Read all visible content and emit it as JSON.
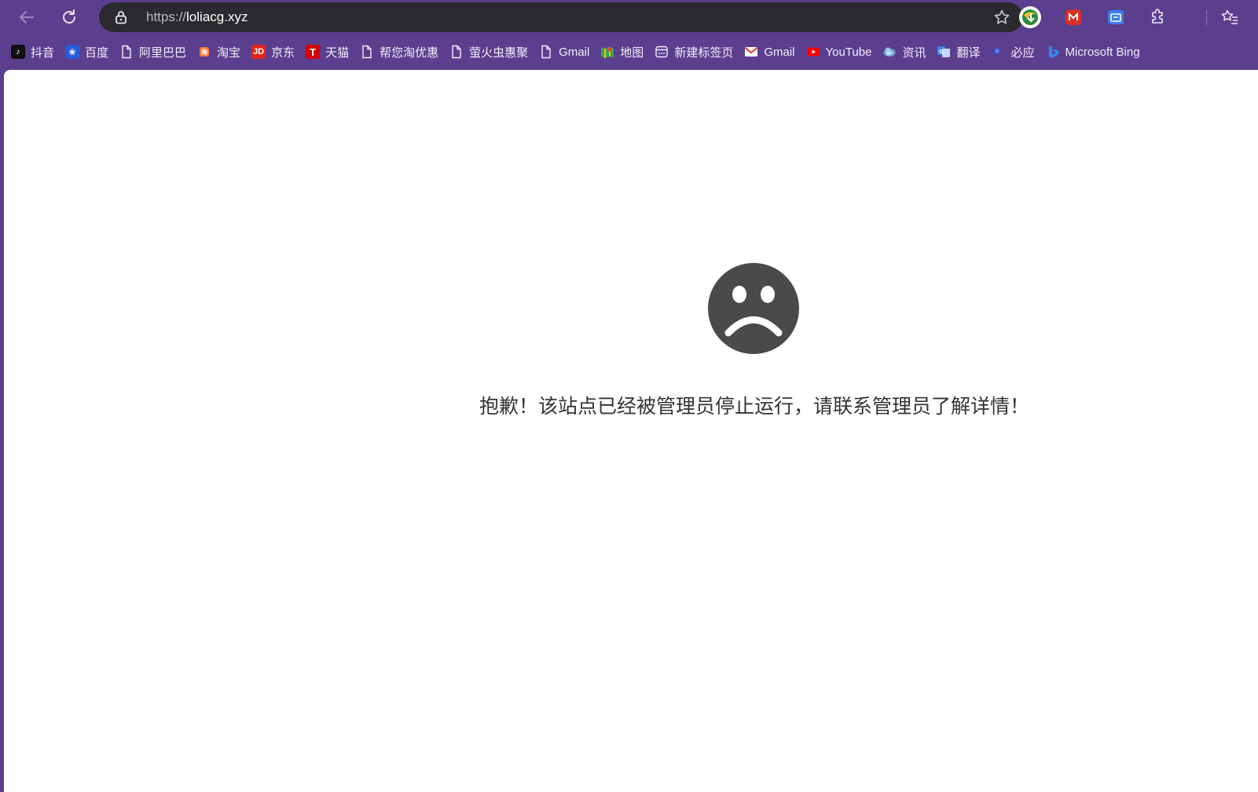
{
  "browser": {
    "url_scheme": "https://",
    "url_host": "loliacg.xyz"
  },
  "bookmarks": [
    {
      "label": "抖音",
      "icon": "douyin-icon",
      "color": "#111111"
    },
    {
      "label": "百度",
      "icon": "baidu-icon",
      "color": "#2a5bd7"
    },
    {
      "label": "阿里巴巴",
      "icon": "page-icon",
      "color": ""
    },
    {
      "label": "淘宝",
      "icon": "taobao-icon",
      "color": "#ff5000"
    },
    {
      "label": "京东",
      "icon": "jd-icon",
      "color": "#e1251b"
    },
    {
      "label": "天猫",
      "icon": "tmall-icon",
      "color": "#d40000"
    },
    {
      "label": "帮您淘优惠",
      "icon": "page-icon",
      "color": ""
    },
    {
      "label": "萤火虫惠聚",
      "icon": "page-icon",
      "color": ""
    },
    {
      "label": "Gmail",
      "icon": "page-icon",
      "color": ""
    },
    {
      "label": "地图",
      "icon": "maps-icon",
      "color": "#34a853"
    },
    {
      "label": "新建标签页",
      "icon": "new-tab-icon",
      "color": ""
    },
    {
      "label": "Gmail",
      "icon": "gmail-icon",
      "color": "#ea4335"
    },
    {
      "label": "YouTube",
      "icon": "youtube-icon",
      "color": "#ff0000"
    },
    {
      "label": "资讯",
      "icon": "news-icon",
      "color": "#4a90d9"
    },
    {
      "label": "翻译",
      "icon": "translate-icon",
      "color": "#4285f4"
    },
    {
      "label": "必应",
      "icon": "bing-dot-icon",
      "color": "#3b5bdb"
    },
    {
      "label": "Microsoft Bing",
      "icon": "bing-icon",
      "color": "#2d8cf0"
    }
  ],
  "page": {
    "message": "抱歉！该站点已经被管理员停止运行，请联系管理员了解详情！"
  },
  "colors": {
    "chrome": "#5b3f8e",
    "address_bar": "#2a2a2e",
    "face": "#4a4a4a"
  }
}
